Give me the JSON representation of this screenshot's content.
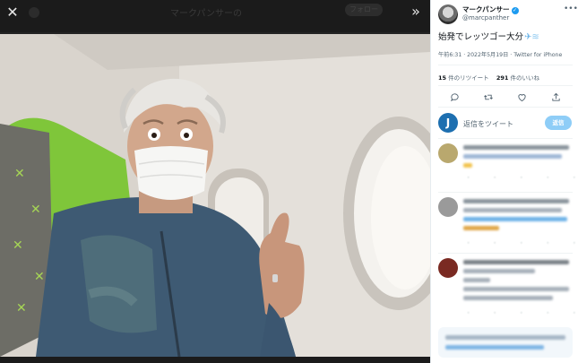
{
  "viewer": {
    "ghost_title": "マークパンサーの",
    "ghost_button": "フォロー",
    "icons": {
      "close": "close-icon",
      "expand": "double-chevron-right-icon"
    }
  },
  "tweet": {
    "display_name": "マークパンサー",
    "handle": "@marcpanther",
    "text": "始発でレッツゴー大分",
    "timestamp": "午前6:31 · 2022年5月19日 · Twitter for iPhone",
    "retweets_count": "15",
    "retweets_label": " 件のリツイート",
    "likes_count": "291",
    "likes_label": " 件のいいね",
    "icons": [
      "reply-icon",
      "retweet-icon",
      "like-icon",
      "share-icon"
    ]
  },
  "reply_box": {
    "avatar_letter": "J",
    "placeholder": "返信をツイート",
    "button": "返信"
  },
  "colors": {
    "accent": "#1d9bf0",
    "reply_button": "#8ecdf7",
    "viewer_bg": "#232323"
  }
}
